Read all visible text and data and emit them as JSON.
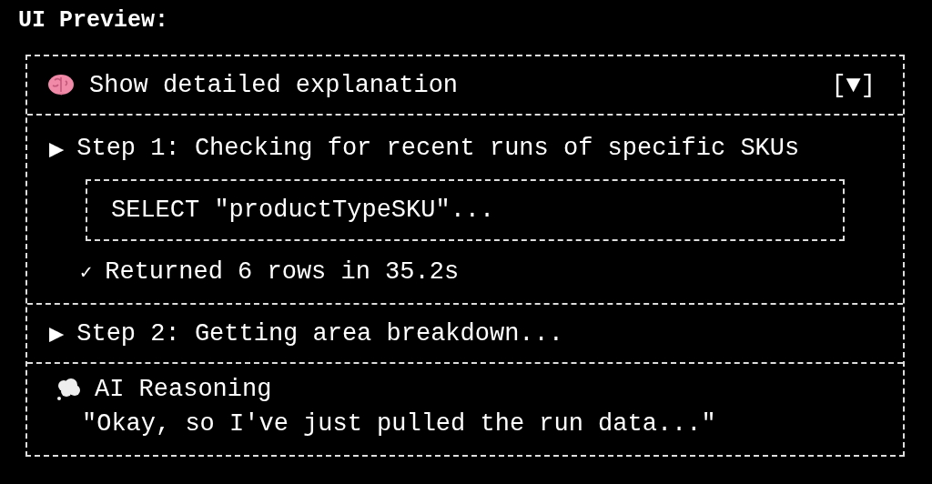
{
  "title": "UI Preview:",
  "toggle": {
    "label": "Show detailed explanation",
    "control": "[▼]"
  },
  "steps": [
    {
      "marker": "▶",
      "label": "Step 1: Checking for recent runs of specific SKUs",
      "query": "SELECT \"productTypeSKU\"...",
      "result_mark": "✓",
      "result": "Returned 6 rows in 35.2s"
    },
    {
      "marker": "▶",
      "label": "Step 2: Getting area breakdown..."
    }
  ],
  "reasoning": {
    "heading": "AI Reasoning",
    "text": "\"Okay, so I've just pulled the run data...\""
  }
}
